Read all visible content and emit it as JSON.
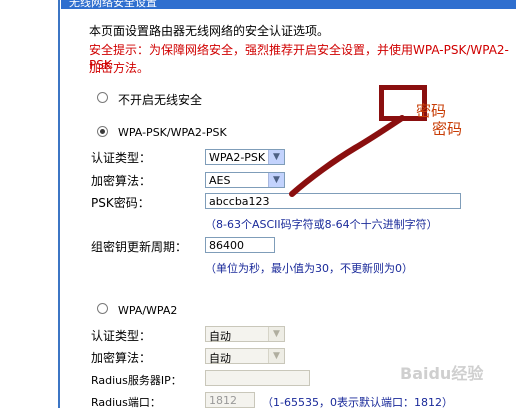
{
  "header": {
    "title": "无线网络安全设置"
  },
  "intro": "本页面设置路由器无线网络的安全认证选项。",
  "tip_line1": "安全提示：为保障网络安全，强烈推荐开启安全设置，并使用WPA-PSK/WPA2-PSK",
  "tip_line2": "加密方法。",
  "option_none": {
    "label": "不开启无线安全"
  },
  "option_psk": {
    "label": "WPA-PSK/WPA2-PSK",
    "auth_type_label": "认证类型：",
    "auth_type_value": "WPA2-PSK",
    "encrypt_label": "加密算法：",
    "encrypt_value": "AES",
    "psk_label": "PSK密码：",
    "psk_value": "abccba123",
    "psk_hint": "（8-63个ASCII码字符或8-64个十六进制字符）",
    "renew_label": "组密钥更新周期：",
    "renew_value": "86400",
    "renew_hint": "（单位为秒，最小值为30，不更新则为0）"
  },
  "option_wpa": {
    "label": "WPA/WPA2",
    "auth_type_label": "认证类型：",
    "auth_type_value": "自动",
    "encrypt_label": "加密算法：",
    "encrypt_value": "自动",
    "radius_ip_label": "Radius服务器IP：",
    "radius_ip_value": "",
    "radius_port_label": "Radius端口：",
    "radius_port_value": "1812",
    "radius_port_hint": "（1-65535，0表示默认端口：1812）"
  },
  "annotation": {
    "text1": "密码",
    "text2": "密码"
  },
  "watermark": "Baidu经验",
  "colors": {
    "accent": "#2f6fcf",
    "warning": "#d00000",
    "annotation": "#8a0f0f"
  }
}
